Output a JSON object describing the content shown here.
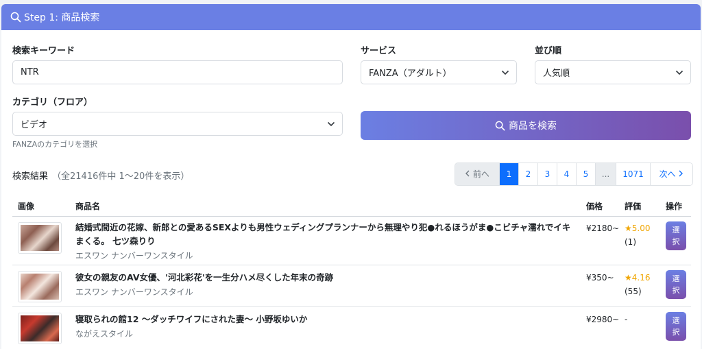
{
  "header": {
    "title": "Step 1: 商品検索"
  },
  "form": {
    "keyword_label": "検索キーワード",
    "keyword_value": "NTR",
    "service_label": "サービス",
    "service_value": "FANZA（アダルト）",
    "sort_label": "並び順",
    "sort_value": "人気順",
    "category_label": "カテゴリ（フロア）",
    "category_value": "ビデオ",
    "category_help": "FANZAのカテゴリを選択",
    "search_button": "商品を検索"
  },
  "results": {
    "label": "検索結果",
    "summary": "（全21416件中 1〜20件を表示）"
  },
  "pagination": {
    "prev": "前へ",
    "pages": [
      "1",
      "2",
      "3",
      "4",
      "5"
    ],
    "ellipsis": "...",
    "last": "1071",
    "next": "次へ",
    "current": "1"
  },
  "table": {
    "headers": [
      "画像",
      "商品名",
      "価格",
      "評価",
      "操作"
    ],
    "select_label": "選択",
    "rows": [
      {
        "title": "結婚式間近の花嫁、新郎との愛あるSEXよりも男性ウェディングプランナーから無理やり犯●れるほうがま●こビチャ濡れでイキまくる。 七ツ森りり",
        "maker": "エスワン ナンバーワンスタイル",
        "price": "¥2180~",
        "rating": "★5.00",
        "reviews": "(1)"
      },
      {
        "title": "彼女の親友のAV女優、'河北彩花'を一生分ハメ尽くした年末の奇跡",
        "maker": "エスワン ナンバーワンスタイル",
        "price": "¥350~",
        "rating": "★4.16",
        "reviews": "(55)"
      },
      {
        "title": "寝取られの館12 ～ダッチワイフにされた妻～ 小野坂ゆいか",
        "maker": "ながえスタイル",
        "price": "¥2980~",
        "rating": "-",
        "reviews": ""
      }
    ]
  },
  "colors": {
    "header_bg": "#6a7fe4",
    "primary": "#0d6efd",
    "button_gradient_start": "#6b7fe3",
    "button_gradient_end": "#7a4fac",
    "star": "#f0a500"
  },
  "icons": [
    "search-icon",
    "chevron-down-icon",
    "chevron-left-icon",
    "chevron-right-icon"
  ]
}
